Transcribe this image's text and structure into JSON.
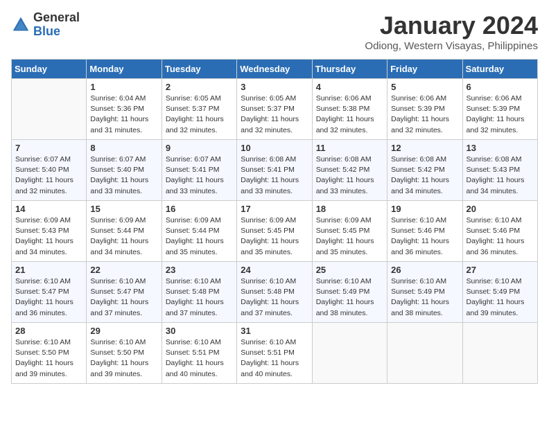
{
  "header": {
    "logo_general": "General",
    "logo_blue": "Blue",
    "month_title": "January 2024",
    "location": "Odiong, Western Visayas, Philippines"
  },
  "days_of_week": [
    "Sunday",
    "Monday",
    "Tuesday",
    "Wednesday",
    "Thursday",
    "Friday",
    "Saturday"
  ],
  "weeks": [
    [
      {
        "day": "",
        "info": ""
      },
      {
        "day": "1",
        "info": "Sunrise: 6:04 AM\nSunset: 5:36 PM\nDaylight: 11 hours\nand 31 minutes."
      },
      {
        "day": "2",
        "info": "Sunrise: 6:05 AM\nSunset: 5:37 PM\nDaylight: 11 hours\nand 32 minutes."
      },
      {
        "day": "3",
        "info": "Sunrise: 6:05 AM\nSunset: 5:37 PM\nDaylight: 11 hours\nand 32 minutes."
      },
      {
        "day": "4",
        "info": "Sunrise: 6:06 AM\nSunset: 5:38 PM\nDaylight: 11 hours\nand 32 minutes."
      },
      {
        "day": "5",
        "info": "Sunrise: 6:06 AM\nSunset: 5:39 PM\nDaylight: 11 hours\nand 32 minutes."
      },
      {
        "day": "6",
        "info": "Sunrise: 6:06 AM\nSunset: 5:39 PM\nDaylight: 11 hours\nand 32 minutes."
      }
    ],
    [
      {
        "day": "7",
        "info": "Sunrise: 6:07 AM\nSunset: 5:40 PM\nDaylight: 11 hours\nand 32 minutes."
      },
      {
        "day": "8",
        "info": "Sunrise: 6:07 AM\nSunset: 5:40 PM\nDaylight: 11 hours\nand 33 minutes."
      },
      {
        "day": "9",
        "info": "Sunrise: 6:07 AM\nSunset: 5:41 PM\nDaylight: 11 hours\nand 33 minutes."
      },
      {
        "day": "10",
        "info": "Sunrise: 6:08 AM\nSunset: 5:41 PM\nDaylight: 11 hours\nand 33 minutes."
      },
      {
        "day": "11",
        "info": "Sunrise: 6:08 AM\nSunset: 5:42 PM\nDaylight: 11 hours\nand 33 minutes."
      },
      {
        "day": "12",
        "info": "Sunrise: 6:08 AM\nSunset: 5:42 PM\nDaylight: 11 hours\nand 34 minutes."
      },
      {
        "day": "13",
        "info": "Sunrise: 6:08 AM\nSunset: 5:43 PM\nDaylight: 11 hours\nand 34 minutes."
      }
    ],
    [
      {
        "day": "14",
        "info": "Sunrise: 6:09 AM\nSunset: 5:43 PM\nDaylight: 11 hours\nand 34 minutes."
      },
      {
        "day": "15",
        "info": "Sunrise: 6:09 AM\nSunset: 5:44 PM\nDaylight: 11 hours\nand 34 minutes."
      },
      {
        "day": "16",
        "info": "Sunrise: 6:09 AM\nSunset: 5:44 PM\nDaylight: 11 hours\nand 35 minutes."
      },
      {
        "day": "17",
        "info": "Sunrise: 6:09 AM\nSunset: 5:45 PM\nDaylight: 11 hours\nand 35 minutes."
      },
      {
        "day": "18",
        "info": "Sunrise: 6:09 AM\nSunset: 5:45 PM\nDaylight: 11 hours\nand 35 minutes."
      },
      {
        "day": "19",
        "info": "Sunrise: 6:10 AM\nSunset: 5:46 PM\nDaylight: 11 hours\nand 36 minutes."
      },
      {
        "day": "20",
        "info": "Sunrise: 6:10 AM\nSunset: 5:46 PM\nDaylight: 11 hours\nand 36 minutes."
      }
    ],
    [
      {
        "day": "21",
        "info": "Sunrise: 6:10 AM\nSunset: 5:47 PM\nDaylight: 11 hours\nand 36 minutes."
      },
      {
        "day": "22",
        "info": "Sunrise: 6:10 AM\nSunset: 5:47 PM\nDaylight: 11 hours\nand 37 minutes."
      },
      {
        "day": "23",
        "info": "Sunrise: 6:10 AM\nSunset: 5:48 PM\nDaylight: 11 hours\nand 37 minutes."
      },
      {
        "day": "24",
        "info": "Sunrise: 6:10 AM\nSunset: 5:48 PM\nDaylight: 11 hours\nand 37 minutes."
      },
      {
        "day": "25",
        "info": "Sunrise: 6:10 AM\nSunset: 5:49 PM\nDaylight: 11 hours\nand 38 minutes."
      },
      {
        "day": "26",
        "info": "Sunrise: 6:10 AM\nSunset: 5:49 PM\nDaylight: 11 hours\nand 38 minutes."
      },
      {
        "day": "27",
        "info": "Sunrise: 6:10 AM\nSunset: 5:49 PM\nDaylight: 11 hours\nand 39 minutes."
      }
    ],
    [
      {
        "day": "28",
        "info": "Sunrise: 6:10 AM\nSunset: 5:50 PM\nDaylight: 11 hours\nand 39 minutes."
      },
      {
        "day": "29",
        "info": "Sunrise: 6:10 AM\nSunset: 5:50 PM\nDaylight: 11 hours\nand 39 minutes."
      },
      {
        "day": "30",
        "info": "Sunrise: 6:10 AM\nSunset: 5:51 PM\nDaylight: 11 hours\nand 40 minutes."
      },
      {
        "day": "31",
        "info": "Sunrise: 6:10 AM\nSunset: 5:51 PM\nDaylight: 11 hours\nand 40 minutes."
      },
      {
        "day": "",
        "info": ""
      },
      {
        "day": "",
        "info": ""
      },
      {
        "day": "",
        "info": ""
      }
    ]
  ]
}
